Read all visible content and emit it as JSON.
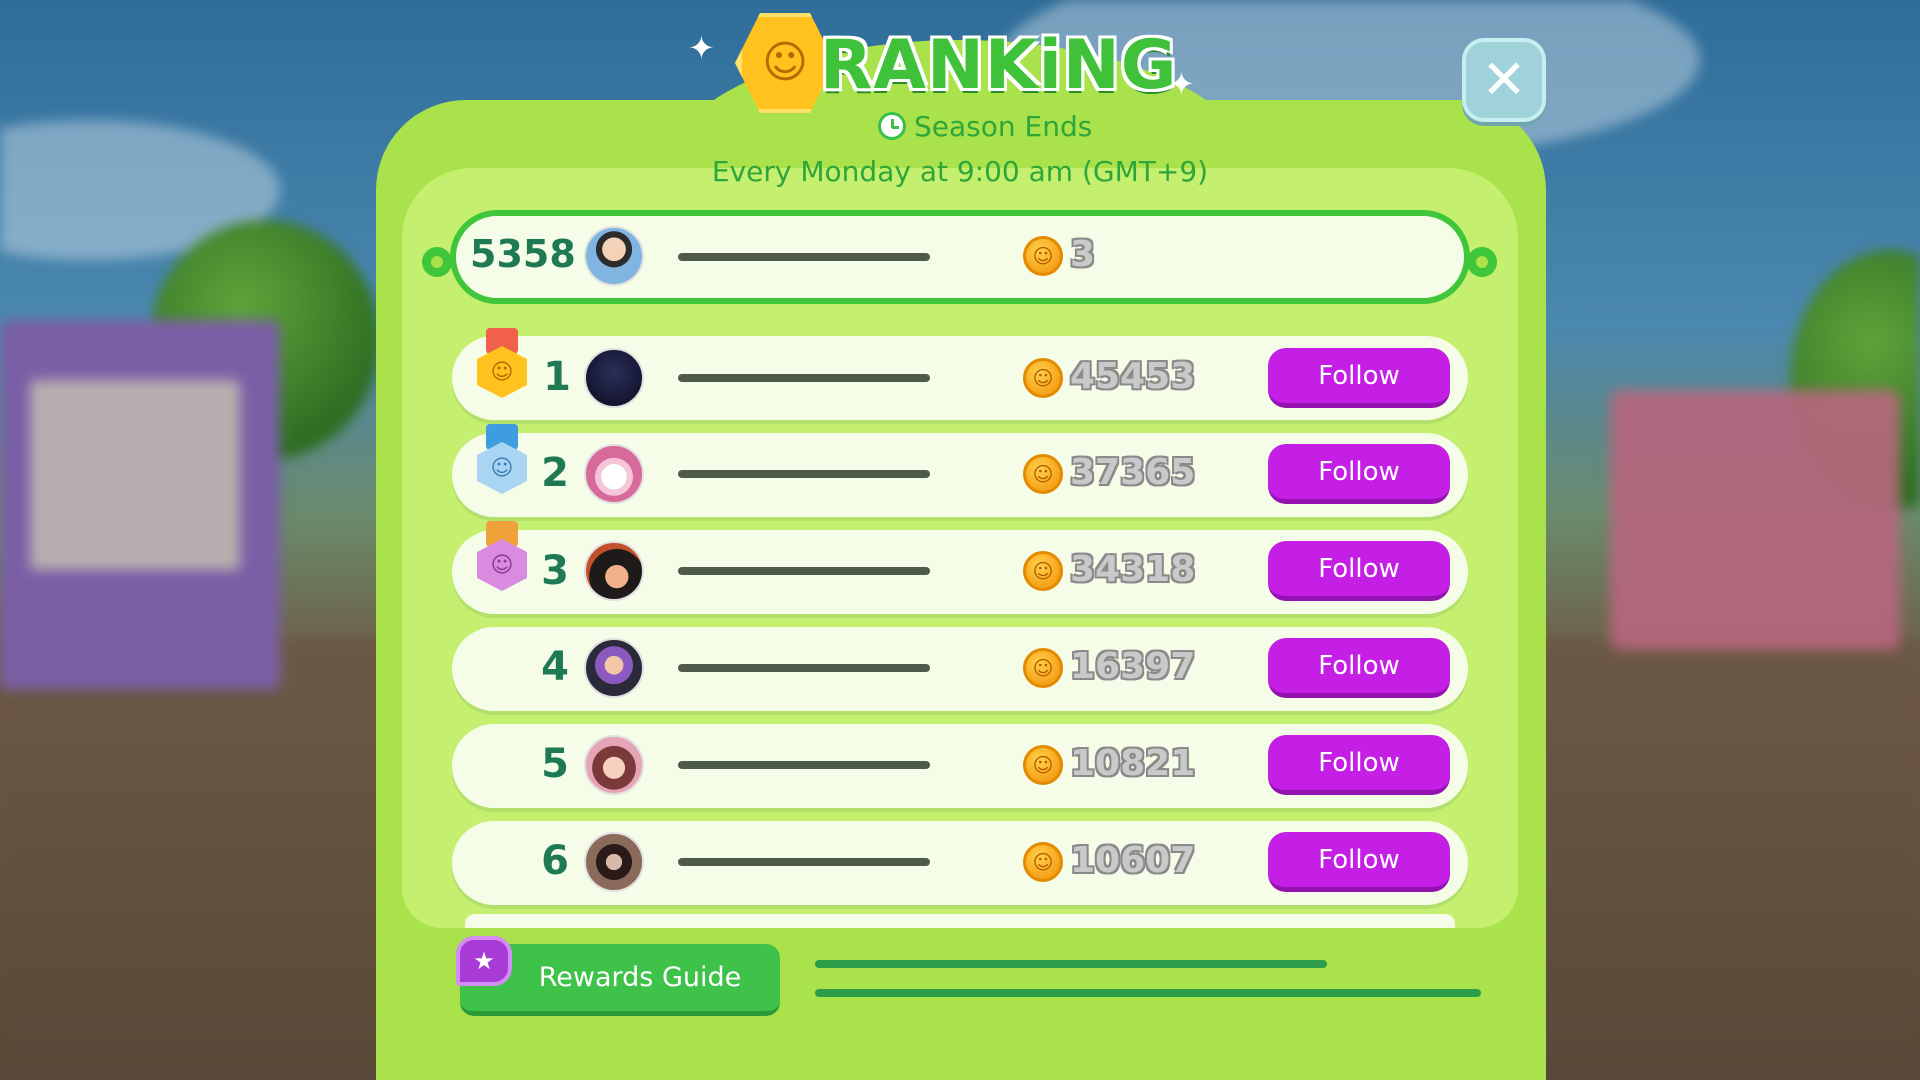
{
  "title": "RANKiNG",
  "season": {
    "label": "Season Ends",
    "schedule": "Every Monday at 9:00 am (GMT+9)"
  },
  "close_icon": "close-icon",
  "me": {
    "rank": "5358",
    "score": "3"
  },
  "leaderboard": [
    {
      "rank": "1",
      "score": "45453",
      "medal": "gold",
      "follow_label": "Follow"
    },
    {
      "rank": "2",
      "score": "37365",
      "medal": "silver",
      "follow_label": "Follow"
    },
    {
      "rank": "3",
      "score": "34318",
      "medal": "bronze",
      "follow_label": "Follow"
    },
    {
      "rank": "4",
      "score": "16397",
      "medal": "",
      "follow_label": "Follow"
    },
    {
      "rank": "5",
      "score": "10821",
      "medal": "",
      "follow_label": "Follow"
    },
    {
      "rank": "6",
      "score": "10607",
      "medal": "",
      "follow_label": "Follow"
    }
  ],
  "footer": {
    "rewards_label": "Rewards Guide"
  },
  "colors": {
    "panel": "#a9e24a",
    "follow": "#c51fe6",
    "rank_text": "#1f7a54",
    "accent_green": "#3fc63a"
  }
}
